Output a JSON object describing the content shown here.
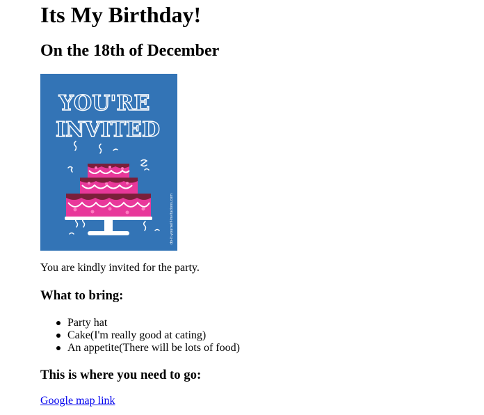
{
  "page": {
    "title": "Its My Birthday!",
    "subtitle": "On the 18th of December",
    "image": {
      "headline_line1": "YOU'RE",
      "headline_line2": "INVITED",
      "watermark": "do-it-yourself-invitations.com"
    },
    "intro_text": "You are kindly invited for the party.",
    "bring_heading": "What to bring:",
    "bring_items": [
      "Party hat",
      "Cake(I'm really good at cating)",
      "An appetite(There will be lots of food)"
    ],
    "go_heading": "This is where you need to go:",
    "map_link_text": "Google map link"
  },
  "colors": {
    "invite_background": "#3374b6",
    "cake_pink": "#e8389a",
    "cake_dark": "#7a1f3a",
    "link": "#0000ee"
  }
}
